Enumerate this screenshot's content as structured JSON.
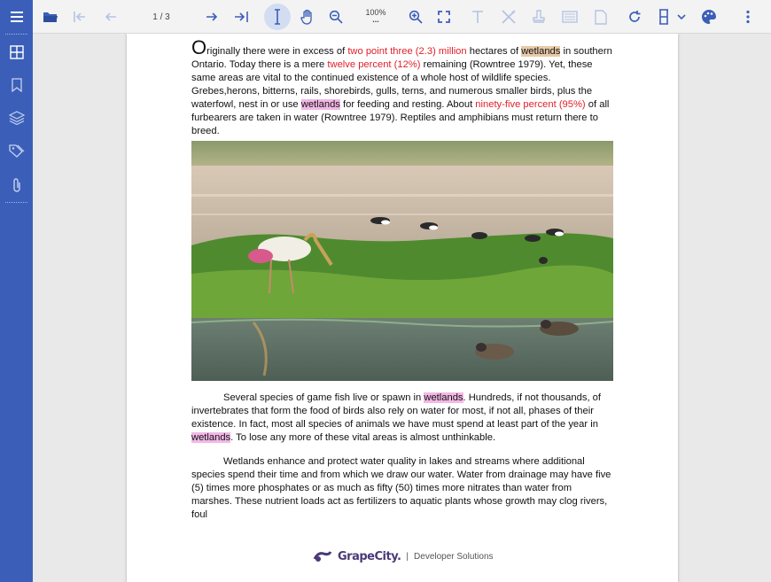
{
  "toolbar": {
    "page_indicator": "1 / 3",
    "zoom_level": "100%",
    "zoom_more": "..."
  },
  "document": {
    "para1": {
      "dropcap": "O",
      "t1": "riginally there were in excess of ",
      "r1": "two point three (2.3) million",
      "t2": " hectares of ",
      "h1": "wetlands",
      "t3": " in southern Ontario. Today there is a mere ",
      "r2": "twelve percent (12%)",
      "t4": " remaining (Rowntree 1979). Yet, these same areas are vital to the continued existence of a whole host of wildlife species. Grebes,herons, bitterns, rails, shorebirds, gulls, terns, and numerous smaller birds, plus the waterfowl, nest in or use ",
      "h2": "wetlands",
      "t5": " for feeding and resting. About ",
      "r3": "ninety-five percent (95%)",
      "t6": " of all furbearers are taken in water (Rowntree 1979). Reptiles and amphibians must return there to breed."
    },
    "para2": {
      "t1": "Several species of game fish live or spawn in ",
      "h1": "wetlands",
      "t2": ". Hundreds, if not thousands, of invertebrates that form the food of birds also rely on water for most, if not all, phases of their existence. In fact, most all species of animals we have must spend at least part of the year in ",
      "h2": "wetlands",
      "t3": ". To lose any more of these vital areas is almost unthinkable."
    },
    "para3": {
      "t1": "Wetlands enhance and protect water quality in lakes and streams where additional species spend their time and from which we draw our water. Water from drainage may have five (5) times more phosphates or as much as fifty (50) times more nitrates than water from marshes. These nutrient loads act as fertilizers to aquatic plants whose growth may clog rivers, foul"
    },
    "footer": {
      "logo": "GrapeCity.",
      "separator": "|",
      "tagline": "Developer Solutions"
    }
  },
  "colors": {
    "sidebar": "#3b5fb8",
    "accent": "#3b5fb8",
    "highlight_red": "#e0202a",
    "highlight_tan": "#e8c9a8",
    "highlight_pink": "#f2b8e6"
  },
  "icons": {
    "sidebar": [
      "hamburger-icon",
      "thumbnails-icon",
      "bookmark-icon",
      "layers-icon",
      "tags-icon",
      "attachment-icon"
    ],
    "toolbar": [
      "open-folder-icon",
      "first-page-icon",
      "previous-page-icon",
      "next-page-icon",
      "last-page-icon",
      "text-select-icon",
      "pan-hand-icon",
      "zoom-out-icon",
      "zoom-in-icon",
      "fullscreen-icon",
      "text-tool-icon",
      "edit-tools-icon",
      "stamp-icon",
      "form-icon",
      "page-icon",
      "rotate-icon",
      "view-mode-icon",
      "theme-palette-icon",
      "more-icon"
    ]
  }
}
